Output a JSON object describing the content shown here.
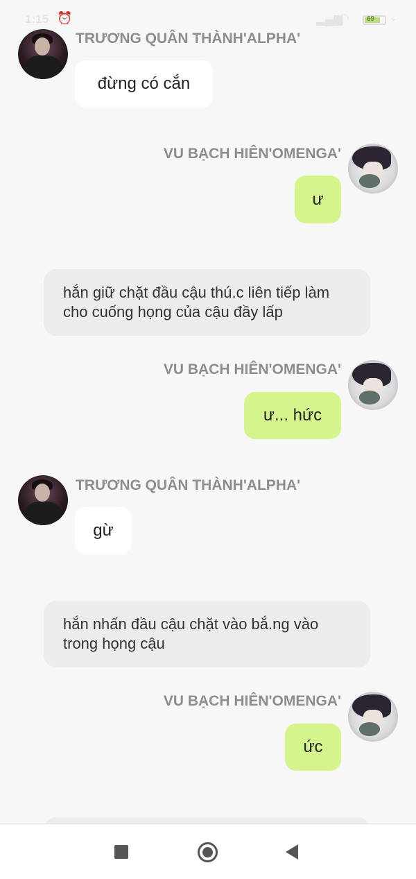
{
  "status_bar": {
    "time": "1:15",
    "battery": "69"
  },
  "characters": {
    "alpha": "TRƯƠNG QUÂN THÀNH'ALPHA'",
    "omega": "VU BẠCH HIÊN'OMENGA'"
  },
  "messages": [
    {
      "type": "left",
      "sender": "TRƯƠNG QUÂN THÀNH'ALPHA'",
      "text": "đừng có cắn"
    },
    {
      "type": "right",
      "sender": "VU BẠCH HIÊN'OMENGA'",
      "text": "ư"
    },
    {
      "type": "narration",
      "text": "hắn giữ chặt đầu cậu thú.c liên tiếp làm cho cuống họng của cậu đầy lấp"
    },
    {
      "type": "right",
      "sender": "VU BẠCH HIÊN'OMENGA'",
      "text": "ư... hức"
    },
    {
      "type": "left",
      "sender": "TRƯƠNG QUÂN THÀNH'ALPHA'",
      "text": "gừ"
    },
    {
      "type": "narration",
      "text": "hắn nhấn đầu cậu chặt vào bắ.ng vào trong họng cậu"
    },
    {
      "type": "right",
      "sender": "VU BẠCH HIÊN'OMENGA'",
      "text": "ức"
    }
  ],
  "colors": {
    "background": "#f7f7f7",
    "own_bubble": "#d5f48c",
    "other_bubble": "#ffffff",
    "narration_bubble": "#ececec",
    "sender_name": "#8d8d8d"
  },
  "icons": {
    "nav_recent": "square-icon",
    "nav_home": "circle-home-icon",
    "nav_back": "triangle-back-icon"
  }
}
